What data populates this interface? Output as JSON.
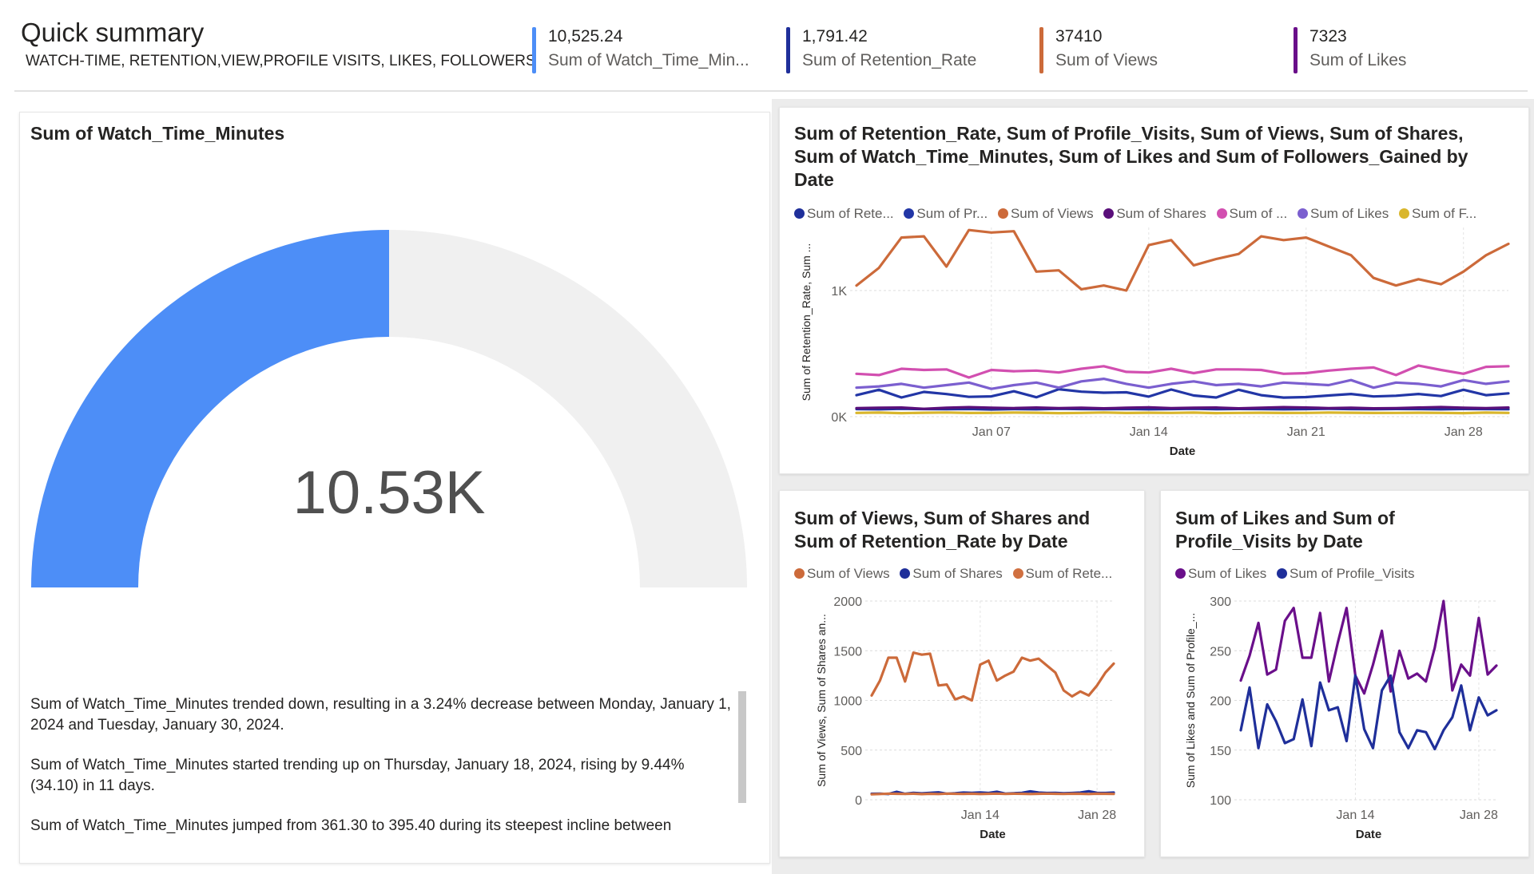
{
  "header": {
    "title": "Quick summary",
    "subtitle": "WATCH-TIME, RETENTION,VIEW,PROFILE VISITS, LIKES, FOLLOWERS",
    "kpis": [
      {
        "value": "10,525.24",
        "label": "Sum of Watch_Time_Min...",
        "color": "#4d8ef7"
      },
      {
        "value": "1,791.42",
        "label": "Sum of Retention_Rate",
        "color": "#1f2f9a"
      },
      {
        "value": "37410",
        "label": "Sum of Views",
        "color": "#cc6a3a"
      },
      {
        "value": "7323",
        "label": "Sum of Likes",
        "color": "#6a0f8a"
      }
    ]
  },
  "gauge": {
    "title": "Sum of Watch_Time_Minutes",
    "value_label": "10.53K",
    "fill_fraction": 0.5,
    "fill_color": "#4d8ef7",
    "track_color": "#f0f0f0"
  },
  "narrative": [
    "Sum of Watch_Time_Minutes trended down, resulting in a 3.24% decrease between Monday, January 1, 2024 and Tuesday, January 30, 2024.",
    "Sum of Watch_Time_Minutes started trending up on Thursday, January 18, 2024, rising by 9.44% (34.10) in 11 days.",
    "Sum of Watch_Time_Minutes jumped from 361.30 to 395.40 during its steepest incline between"
  ],
  "chart_data": [
    {
      "type": "line",
      "title": "Sum of Retention_Rate, Sum of Profile_Visits, Sum of Views, Sum of Shares, Sum of Watch_Time_Minutes, Sum of Likes and Sum of Followers_Gained by Date",
      "xlabel": "Date",
      "ylabel": "Sum of Retention_Rate, Sum ...",
      "x": [
        1,
        2,
        3,
        4,
        5,
        6,
        7,
        8,
        9,
        10,
        11,
        12,
        13,
        14,
        15,
        16,
        17,
        18,
        19,
        20,
        21,
        22,
        23,
        24,
        25,
        26,
        27,
        28,
        29,
        30
      ],
      "x_ticks": [
        {
          "x": 7,
          "label": "Jan 07"
        },
        {
          "x": 14,
          "label": "Jan 14"
        },
        {
          "x": 21,
          "label": "Jan 21"
        },
        {
          "x": 28,
          "label": "Jan 28"
        }
      ],
      "y_ticks": [
        {
          "y": 0,
          "label": "0K"
        },
        {
          "y": 1000,
          "label": "1K"
        }
      ],
      "ylim": [
        0,
        1500
      ],
      "legend_labels": [
        "Sum of Rete...",
        "Sum of Pr...",
        "Sum of Views",
        "Sum of Shares",
        "Sum of ...",
        "Sum of Likes",
        "Sum of F..."
      ],
      "series": [
        {
          "name": "Sum of Retention_Rate",
          "color": "#1f2f9a",
          "values": [
            60,
            58,
            62,
            60,
            59,
            61,
            57,
            60,
            58,
            62,
            60,
            59,
            61,
            58,
            60,
            62,
            59,
            61,
            60,
            58,
            60,
            62,
            60,
            59,
            61,
            60,
            58,
            61,
            60,
            59
          ]
        },
        {
          "name": "Sum of Profile_Visits",
          "color": "#2236a6",
          "values": [
            170,
            213,
            152,
            196,
            179,
            157,
            161,
            201,
            154,
            218,
            198,
            190,
            193,
            159,
            215,
            168,
            152,
            213,
            170,
            151,
            155,
            168,
            180,
            160,
            166,
            180,
            163,
            213,
            170,
            185
          ]
        },
        {
          "name": "Sum of Views",
          "color": "#cc6a3a",
          "values": [
            1040,
            1180,
            1420,
            1430,
            1190,
            1480,
            1460,
            1470,
            1150,
            1160,
            1010,
            1040,
            1000,
            1360,
            1400,
            1200,
            1250,
            1290,
            1430,
            1400,
            1420,
            1350,
            1280,
            1100,
            1040,
            1090,
            1050,
            1150,
            1280,
            1370
          ]
        },
        {
          "name": "Sum of Shares",
          "color": "#5a0f7a",
          "values": [
            68,
            70,
            72,
            62,
            70,
            75,
            70,
            68,
            72,
            68,
            70,
            66,
            70,
            74,
            68,
            70,
            72,
            66,
            70,
            75,
            72,
            68,
            70,
            66,
            68,
            72,
            76,
            70,
            68,
            72
          ]
        },
        {
          "name": "Sum of Watch_Time_Minutes",
          "color": "#d24fb0",
          "values": [
            340,
            330,
            380,
            370,
            375,
            310,
            370,
            360,
            365,
            350,
            380,
            400,
            355,
            350,
            380,
            345,
            375,
            375,
            370,
            340,
            345,
            365,
            380,
            390,
            330,
            405,
            370,
            340,
            395,
            400
          ]
        },
        {
          "name": "Sum of Likes",
          "color": "#7b5fcf",
          "values": [
            230,
            240,
            260,
            230,
            250,
            270,
            220,
            250,
            270,
            230,
            280,
            300,
            260,
            230,
            260,
            280,
            250,
            260,
            240,
            270,
            260,
            250,
            290,
            230,
            270,
            260,
            240,
            290,
            260,
            280
          ]
        },
        {
          "name": "Sum of Followers_Gained",
          "color": "#d9b62c",
          "values": [
            30,
            32,
            28,
            31,
            33,
            29,
            30,
            32,
            31,
            28,
            30,
            33,
            29,
            31,
            30,
            32,
            28,
            30,
            31,
            29,
            30,
            32,
            31,
            29,
            30,
            31,
            30,
            28,
            32,
            30
          ]
        }
      ]
    },
    {
      "type": "line",
      "title": "Sum of Views, Sum of Shares and Sum of Retention_Rate by Date",
      "xlabel": "Date",
      "ylabel": "Sum of Views, Sum of Shares an...",
      "x": [
        1,
        2,
        3,
        4,
        5,
        6,
        7,
        8,
        9,
        10,
        11,
        12,
        13,
        14,
        15,
        16,
        17,
        18,
        19,
        20,
        21,
        22,
        23,
        24,
        25,
        26,
        27,
        28,
        29,
        30
      ],
      "x_ticks": [
        {
          "x": 14,
          "label": "Jan 14"
        },
        {
          "x": 28,
          "label": "Jan 28"
        }
      ],
      "y_ticks": [
        {
          "y": 0,
          "label": "0"
        },
        {
          "y": 500,
          "label": "500"
        },
        {
          "y": 1000,
          "label": "1000"
        },
        {
          "y": 1500,
          "label": "1500"
        },
        {
          "y": 2000,
          "label": "2000"
        }
      ],
      "ylim": [
        0,
        2000
      ],
      "legend_labels": [
        "Sum of Views",
        "Sum of Shares",
        "Sum of Rete..."
      ],
      "series": [
        {
          "name": "Sum of Views",
          "color": "#cc6a3a",
          "values": [
            1050,
            1200,
            1430,
            1430,
            1190,
            1480,
            1460,
            1470,
            1150,
            1160,
            1010,
            1040,
            1000,
            1360,
            1400,
            1200,
            1250,
            1290,
            1430,
            1400,
            1420,
            1350,
            1280,
            1100,
            1040,
            1090,
            1050,
            1150,
            1280,
            1370
          ]
        },
        {
          "name": "Sum of Shares",
          "color": "#1f2f9a",
          "values": [
            60,
            62,
            58,
            80,
            60,
            70,
            64,
            70,
            75,
            60,
            65,
            72,
            70,
            74,
            68,
            80,
            62,
            66,
            70,
            84,
            72,
            68,
            70,
            66,
            68,
            72,
            86,
            70,
            68,
            72
          ]
        },
        {
          "name": "Sum of Retention_Rate",
          "color": "#d07040",
          "values": [
            55,
            58,
            62,
            60,
            59,
            61,
            57,
            60,
            58,
            62,
            60,
            59,
            61,
            58,
            60,
            62,
            59,
            61,
            60,
            58,
            60,
            62,
            60,
            59,
            61,
            60,
            58,
            61,
            60,
            59
          ]
        }
      ]
    },
    {
      "type": "line",
      "title": "Sum of Likes and Sum of Profile_Visits by Date",
      "xlabel": "Date",
      "ylabel": "Sum of Likes and Sum of Profile_...",
      "x": [
        1,
        2,
        3,
        4,
        5,
        6,
        7,
        8,
        9,
        10,
        11,
        12,
        13,
        14,
        15,
        16,
        17,
        18,
        19,
        20,
        21,
        22,
        23,
        24,
        25,
        26,
        27,
        28,
        29,
        30
      ],
      "x_ticks": [
        {
          "x": 14,
          "label": "Jan 14"
        },
        {
          "x": 28,
          "label": "Jan 28"
        }
      ],
      "y_ticks": [
        {
          "y": 100,
          "label": "100"
        },
        {
          "y": 150,
          "label": "150"
        },
        {
          "y": 200,
          "label": "200"
        },
        {
          "y": 250,
          "label": "250"
        },
        {
          "y": 300,
          "label": "300"
        }
      ],
      "ylim": [
        100,
        300
      ],
      "legend_labels": [
        "Sum of Likes",
        "Sum of Profile_Visits"
      ],
      "series": [
        {
          "name": "Sum of Likes",
          "color": "#6a0f8a",
          "values": [
            220,
            245,
            278,
            226,
            231,
            280,
            293,
            243,
            243,
            288,
            219,
            258,
            293,
            225,
            207,
            236,
            270,
            209,
            250,
            222,
            227,
            219,
            253,
            300,
            210,
            236,
            225,
            283,
            226,
            235
          ]
        },
        {
          "name": "Sum of Profile_Visits",
          "color": "#1f2f9a",
          "values": [
            170,
            213,
            152,
            196,
            179,
            157,
            161,
            201,
            154,
            218,
            190,
            193,
            159,
            225,
            171,
            152,
            210,
            225,
            168,
            152,
            170,
            168,
            151,
            170,
            183,
            215,
            170,
            203,
            185,
            190
          ]
        }
      ]
    }
  ]
}
